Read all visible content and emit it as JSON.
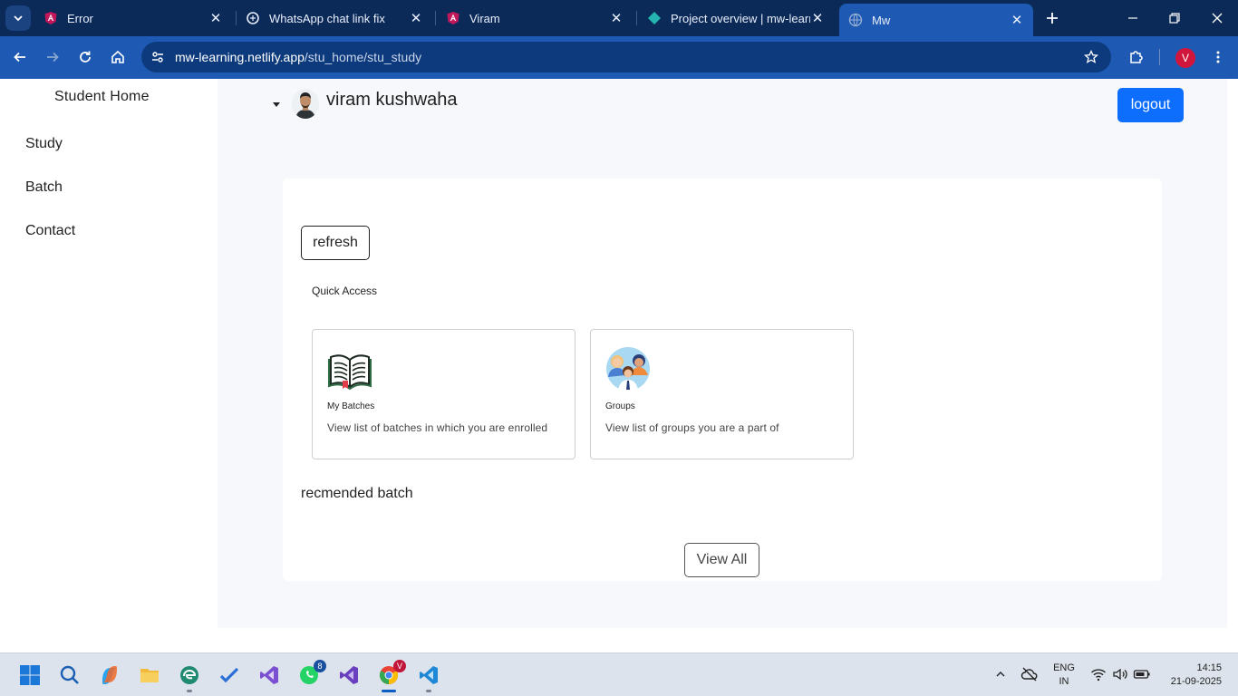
{
  "browser": {
    "tabs": [
      {
        "title": "Error",
        "favicon": "angular-icon",
        "active": false
      },
      {
        "title": "WhatsApp chat link fix",
        "favicon": "openai-icon",
        "active": false
      },
      {
        "title": "Viram",
        "favicon": "angular-icon",
        "active": false
      },
      {
        "title": "Project overview | mw-learni",
        "favicon": "netlify-icon",
        "active": false
      },
      {
        "title": "Mw",
        "favicon": "globe-icon",
        "active": true
      }
    ],
    "url_host": "mw-learning.netlify.app",
    "url_path": "/stu_home/stu_study",
    "profile_initial": "V"
  },
  "sidebar": {
    "title": "Student Home",
    "items": [
      {
        "label": "Study"
      },
      {
        "label": "Batch"
      },
      {
        "label": "Contact"
      }
    ]
  },
  "header": {
    "username": "viram kushwaha",
    "logout_label": "logout"
  },
  "content": {
    "refresh_label": "refresh",
    "quick_access_title": "Quick Access",
    "cards": [
      {
        "name": "My Batches",
        "description": "View list of batches in which you are enrolled",
        "icon": "open-book-icon"
      },
      {
        "name": "Groups",
        "description": "View list of groups you are a part of",
        "icon": "people-group-icon"
      }
    ],
    "recommended_title": "recmended batch",
    "view_all_label": "View All"
  },
  "taskbar": {
    "whatsapp_badge": "8",
    "chrome_badge": "V",
    "language_line1": "ENG",
    "language_line2": "IN",
    "time": "14:15",
    "date": "21-09-2025"
  },
  "colors": {
    "primary": "#0d6efd",
    "chrome_dark": "#0b2a57",
    "chrome_toolbar": "#1e5ab3",
    "page_bg": "#f7f8fb"
  }
}
